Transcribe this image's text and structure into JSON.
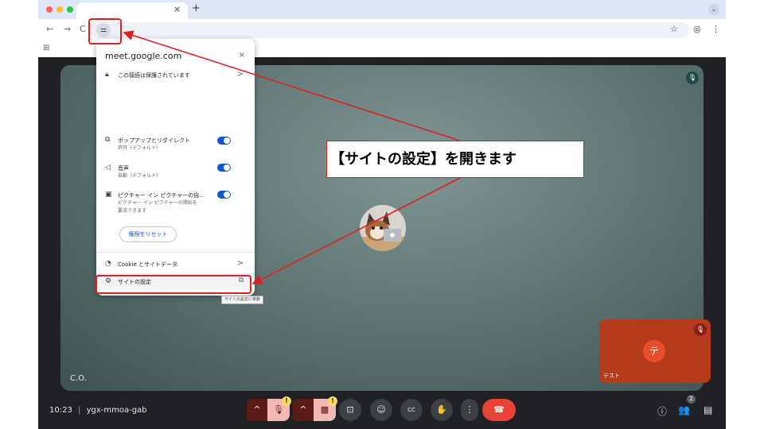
{
  "browser": {
    "new_tab_symbol": "+",
    "close_tab_symbol": "×",
    "back_symbol": "←",
    "forward_symbol": "→",
    "reload_symbol": "C",
    "site_info_symbol": "⚌",
    "bookmark_symbol": "☆",
    "profile_symbol": "◎",
    "menu_symbol": "⋮",
    "tab_menu_symbol": "⌄",
    "apps_symbol": "⊞"
  },
  "popup": {
    "host": "meet.google.com",
    "close_symbol": "×",
    "connection_label": "この接続は保護されています",
    "arrow_symbol": ">",
    "permissions": [
      {
        "icon": "⧉",
        "title": "ポップアップとリダイレクト",
        "sub": [
          "許可（デフォルト）"
        ]
      },
      {
        "icon": "◁",
        "title": "音声",
        "sub": [
          "自動（デフォルト）"
        ]
      },
      {
        "icon": "▣",
        "title": "ピクチャー イン ピクチャーの自...",
        "sub": [
          "ピクチャー イン ピクチャーの開始を",
          "要求できます"
        ]
      }
    ],
    "reset_label": "権限をリセット",
    "cookie_label": "Cookie とサイトデータ",
    "site_settings_label": "サイトの設定",
    "tooltip": "サイトの設定に移動"
  },
  "annotation": {
    "callout_text": "【サイトの設定】を開きます",
    "color": "#e02020"
  },
  "meet": {
    "participant_name": "C.O.",
    "self_name": "テスト",
    "self_initial": "テ",
    "time": "10:23",
    "separator": "|",
    "meeting_code": "ygx-mmoa-gab",
    "people_count": "2",
    "warning_symbol": "!",
    "controls": {
      "chevron": "^",
      "mic_off": "🎙",
      "cam_off": "▩",
      "present": "⊡",
      "emoji": "☺",
      "captions": "CC",
      "raise_hand": "✋",
      "more": "⋮",
      "end_call": "☎",
      "info": "ⓘ",
      "people": "👥",
      "chat": "▤"
    },
    "colors": {
      "end_call": "#ea4335",
      "self_tile": "#b53b1a"
    }
  }
}
